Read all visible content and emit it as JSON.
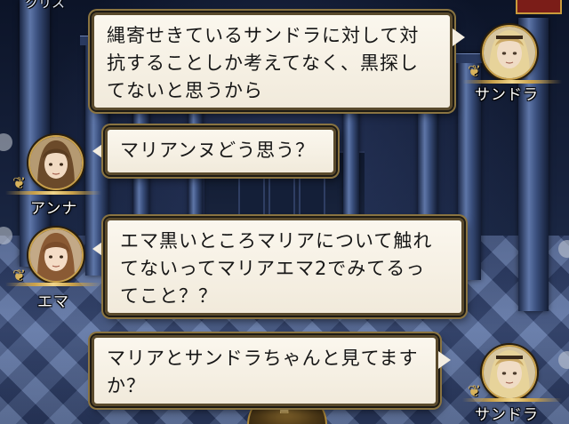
{
  "top_label": "クリス",
  "messages": [
    {
      "speaker": "サンドラ",
      "side": "right",
      "text": "縄寄せきているサンドラに対して対\n抗することしか考えてなく、黒探し\nてないと思うから"
    },
    {
      "speaker": "アンナ",
      "side": "left",
      "text": "マリアンヌどう思う？"
    },
    {
      "speaker": "エマ",
      "side": "left",
      "text": "エマ黒いところマリアについて触れ\nてないってマリアエマ2でみてるっ\nてこと？？"
    },
    {
      "speaker": "サンドラ",
      "side": "right",
      "text": "マリアとサンドラちゃんと見てます\nか？"
    }
  ],
  "colors": {
    "bubble_fill": "#f4eee2",
    "bubble_border": "#5a4a2c",
    "gold_trim": "#c9a049",
    "name_text": "#ffffff",
    "background_dark": "#0c1428"
  },
  "icons": {
    "crest": "lion-crest-icon",
    "flourish": "gold-flourish-icon"
  }
}
